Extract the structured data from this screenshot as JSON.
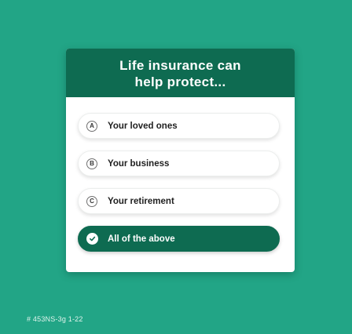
{
  "colors": {
    "background": "#22a586",
    "header": "#0e6b51",
    "selected_option": "#0e6b51",
    "card": "#ffffff"
  },
  "card": {
    "title_line1": "Life insurance can",
    "title_line2": "help protect..."
  },
  "options": [
    {
      "letter": "A",
      "label": "Your loved ones",
      "selected": false
    },
    {
      "letter": "B",
      "label": "Your business",
      "selected": false
    },
    {
      "letter": "C",
      "label": "Your retirement",
      "selected": false
    },
    {
      "letter": "",
      "label": "All of the above",
      "selected": true,
      "icon": "check-circle-icon"
    }
  ],
  "footer": {
    "code": "# 453NS-3g 1-22"
  }
}
